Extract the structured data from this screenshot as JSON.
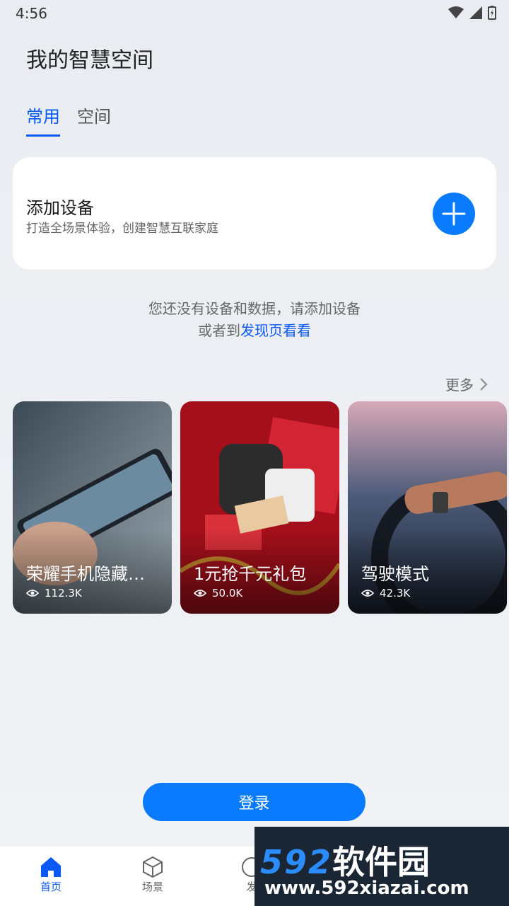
{
  "status": {
    "time": "4:56"
  },
  "header": {
    "title": "我的智慧空间"
  },
  "tabs": [
    {
      "label": "常用",
      "active": true
    },
    {
      "label": "空间",
      "active": false
    }
  ],
  "add_device": {
    "title": "添加设备",
    "subtitle": "打造全场景体验，创建智慧互联家庭"
  },
  "empty": {
    "line1": "您还没有设备和数据，请添加设备",
    "line2_prefix": "或者到",
    "line2_link": "发现页看看"
  },
  "more_label": "更多",
  "cards": [
    {
      "title": "荣耀手机隐藏功...",
      "views": "112.3K"
    },
    {
      "title": "1元抢千元礼包",
      "views": "50.0K"
    },
    {
      "title": "驾驶模式",
      "views": "42.3K"
    }
  ],
  "login_label": "登录",
  "nav": [
    {
      "label": "首页",
      "icon": "home-icon",
      "active": true
    },
    {
      "label": "场景",
      "icon": "cube-icon",
      "active": false
    },
    {
      "label": "发",
      "icon": "discover-icon",
      "active": false
    }
  ],
  "watermark": {
    "brand_num": "592",
    "brand_cn": "软件园",
    "url": "www.592xiazai.com"
  },
  "colors": {
    "accent": "#0a7bff",
    "tab_active": "#0a59f7"
  }
}
